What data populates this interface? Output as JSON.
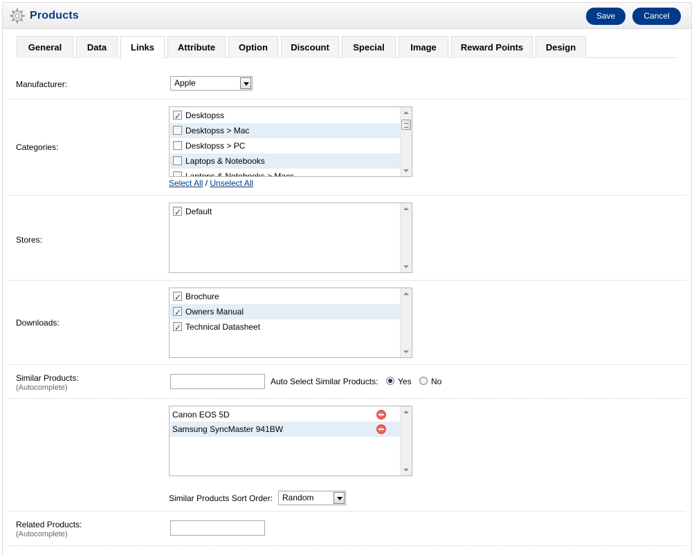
{
  "header": {
    "title": "Products",
    "save_label": "Save",
    "cancel_label": "Cancel"
  },
  "tabs": [
    {
      "label": "General"
    },
    {
      "label": "Data"
    },
    {
      "label": "Links"
    },
    {
      "label": "Attribute"
    },
    {
      "label": "Option"
    },
    {
      "label": "Discount"
    },
    {
      "label": "Special"
    },
    {
      "label": "Image"
    },
    {
      "label": "Reward Points"
    },
    {
      "label": "Design"
    }
  ],
  "active_tab": "Links",
  "manufacturer": {
    "label": "Manufacturer:",
    "value": "Apple"
  },
  "categories": {
    "label": "Categories:",
    "items": [
      {
        "label": "Desktopss",
        "checked": true
      },
      {
        "label": "Desktopss > Mac",
        "checked": false
      },
      {
        "label": "Desktopss > PC",
        "checked": false
      },
      {
        "label": "Laptops & Notebooks",
        "checked": false
      },
      {
        "label": "Laptops & Notebooks > Macs",
        "checked": false
      }
    ],
    "select_all": "Select All",
    "separator": "/",
    "unselect_all": "Unselect All"
  },
  "stores": {
    "label": "Stores:",
    "items": [
      {
        "label": "Default",
        "checked": true
      }
    ]
  },
  "downloads": {
    "label": "Downloads:",
    "items": [
      {
        "label": "Brochure",
        "checked": true
      },
      {
        "label": "Owners Manual",
        "checked": true
      },
      {
        "label": "Technical Datasheet",
        "checked": true
      }
    ]
  },
  "similar": {
    "label": "Similar Products:",
    "hint": "(Autocomplete)",
    "input_value": "",
    "auto_select_label": "Auto Select Similar Products:",
    "yes_label": "Yes",
    "no_label": "No",
    "auto_select": "Yes",
    "items": [
      {
        "label": "Canon EOS 5D"
      },
      {
        "label": "Samsung SyncMaster 941BW"
      }
    ],
    "sort_label": "Similar Products Sort Order:",
    "sort_value": "Random"
  },
  "related": {
    "label": "Related Products:",
    "hint": "(Autocomplete)",
    "input_value": ""
  }
}
